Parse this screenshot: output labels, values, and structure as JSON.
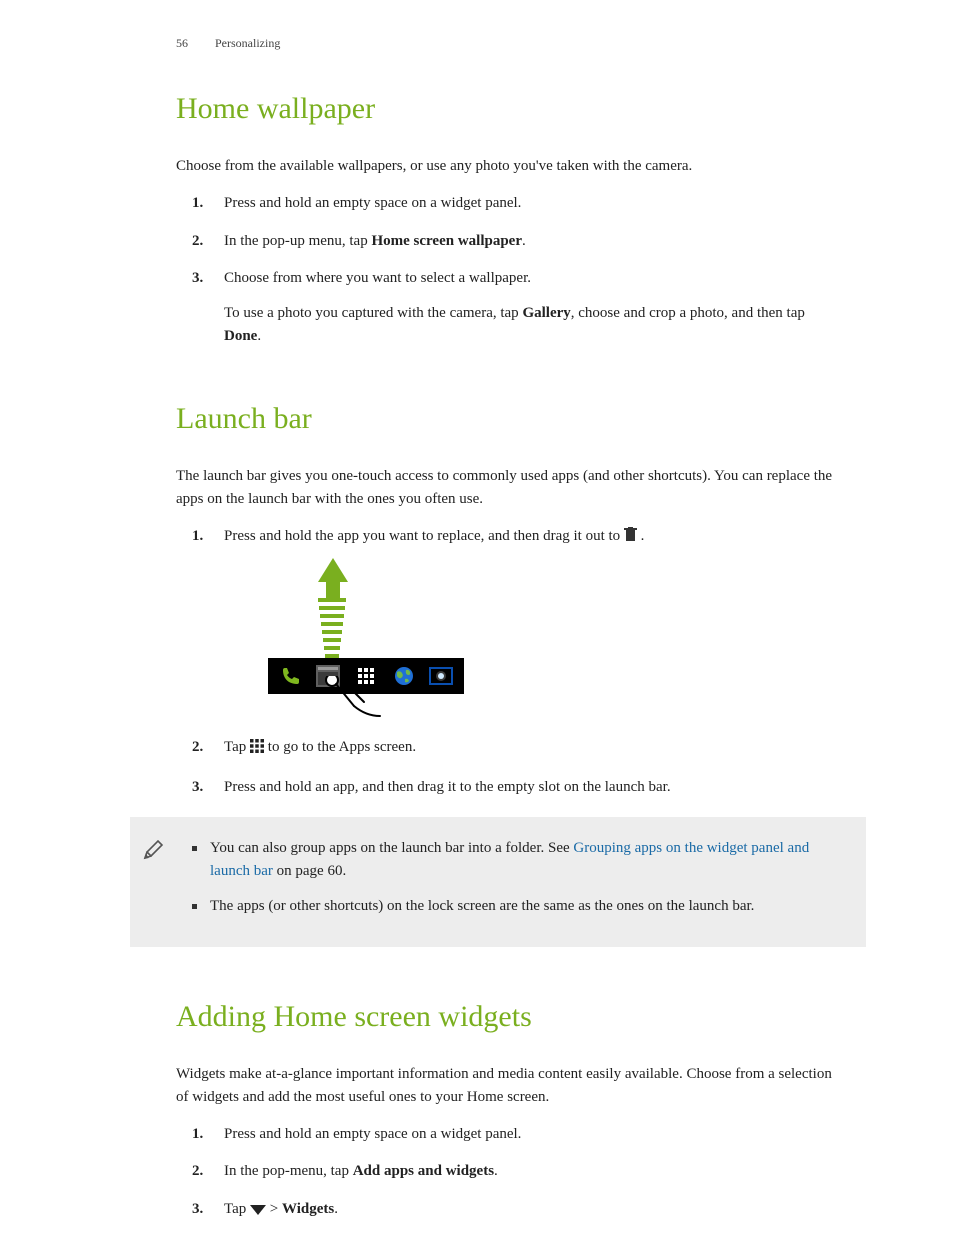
{
  "header": {
    "page_number": "56",
    "section": "Personalizing"
  },
  "s1": {
    "title": "Home wallpaper",
    "intro": "Choose from the available wallpapers, or use any photo you've taken with the camera.",
    "step1": "Press and hold an empty space on a widget panel.",
    "step2_a": "In the pop-up menu, tap ",
    "step2_b": "Home screen wallpaper",
    "step2_c": ".",
    "step3": "Choose from where you want to select a wallpaper.",
    "step3_sub_a": "To use a photo you captured with the camera, tap ",
    "step3_sub_b": "Gallery",
    "step3_sub_c": ", choose and crop a photo, and then tap ",
    "step3_sub_d": "Done",
    "step3_sub_e": "."
  },
  "s2": {
    "title": "Launch bar",
    "intro": "The launch bar gives you one-touch access to commonly used apps (and other shortcuts). You can replace the apps on the launch bar with the ones you often use.",
    "step1_a": "Press and hold the app you want to replace, and then drag it out to ",
    "step1_b": " .",
    "step2_a": "Tap ",
    "step2_b": " to go to the Apps screen.",
    "step3": "Press and hold an app, and then drag it to the empty slot on the launch bar."
  },
  "note": {
    "b1_a": "You can also group apps on the launch bar into a folder. See ",
    "b1_link": "Grouping apps on the widget panel and launch bar",
    "b1_b": " on page 60.",
    "b2": "The apps (or other shortcuts) on the lock screen are the same as the ones on the launch bar."
  },
  "s3": {
    "title": "Adding Home screen widgets",
    "intro": "Widgets make at-a-glance important information and media content easily available. Choose from a selection of widgets and add the most useful ones to your Home screen.",
    "step1": "Press and hold an empty space on a widget panel.",
    "step2_a": "In the pop-menu, tap ",
    "step2_b": "Add apps and widgets",
    "step2_c": ".",
    "step3_a": "Tap ",
    "step3_b": " > ",
    "step3_c": "Widgets",
    "step3_d": "."
  }
}
